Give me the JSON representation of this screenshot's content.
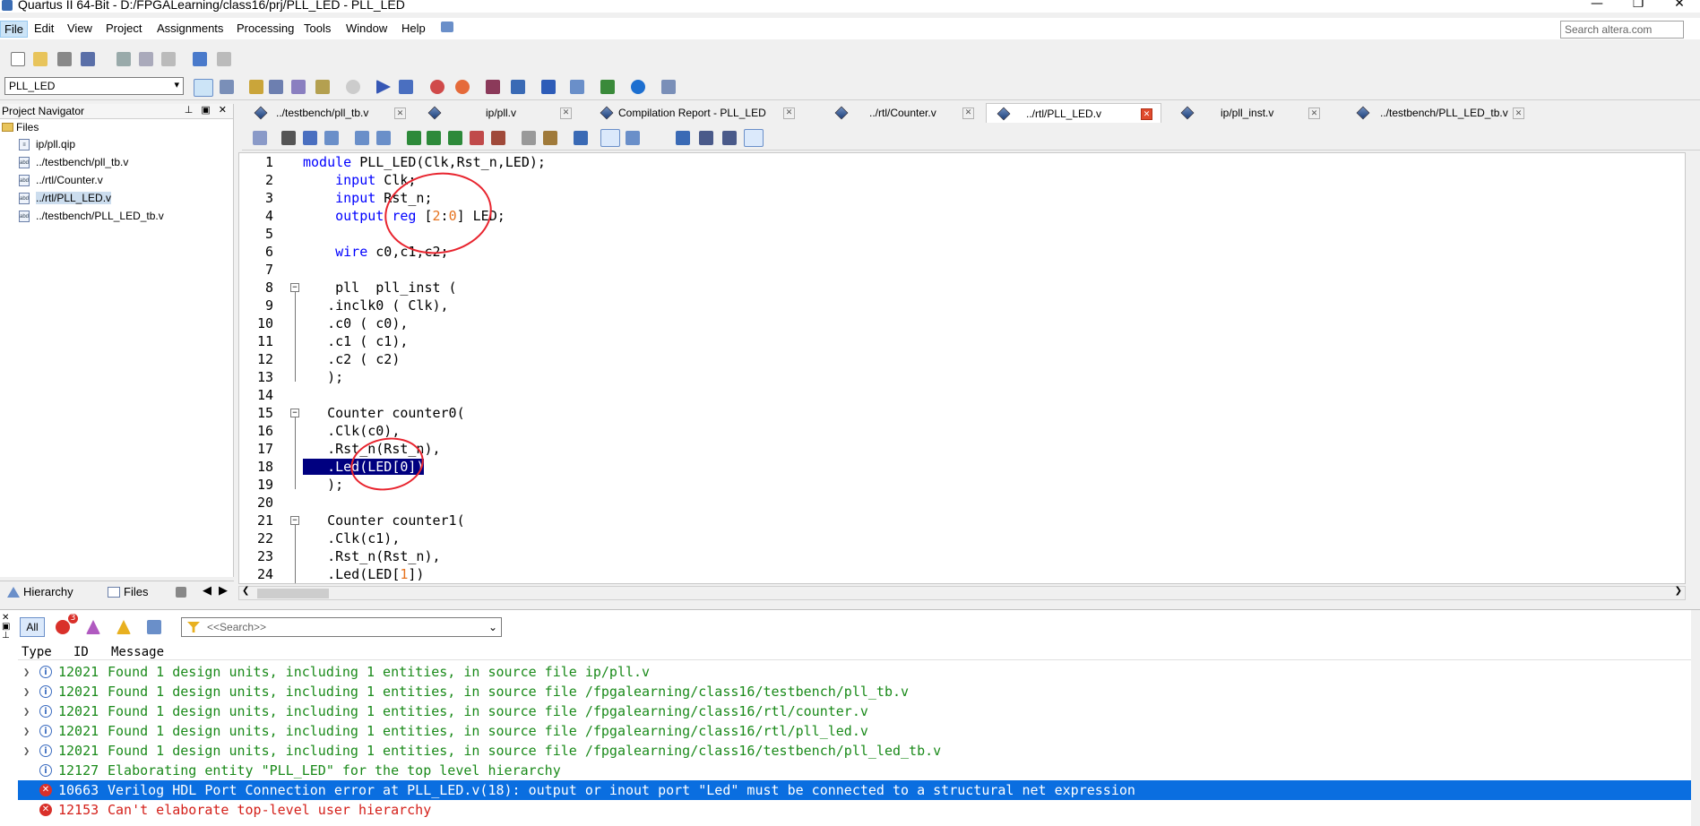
{
  "window": {
    "title": "Quartus II 64-Bit - D:/FPGALearning/class16/prj/PLL_LED - PLL_LED",
    "minimize": "—",
    "maximize": "❐",
    "close": "✕"
  },
  "menu": {
    "items": [
      "File",
      "Edit",
      "View",
      "Project",
      "Assignments",
      "Processing",
      "Tools",
      "Window",
      "Help"
    ],
    "search_placeholder": "Search altera.com"
  },
  "toolbar": {
    "project_select": "PLL_LED"
  },
  "navigator": {
    "title": "Project Navigator",
    "header_buttons": "⊥ ▣ ✕",
    "root": "Files",
    "files": [
      "ip/pll.qip",
      "../testbench/pll_tb.v",
      "../rtl/Counter.v",
      "../rtl/PLL_LED.v",
      "../testbench/PLL_LED_tb.v"
    ],
    "selected_index": 3,
    "tabs": [
      "Hierarchy",
      "Files"
    ]
  },
  "tabs": [
    {
      "label": "../testbench/pll_tb.v",
      "active": false
    },
    {
      "label": "ip/pll.v",
      "active": false
    },
    {
      "label": "Compilation Report - PLL_LED",
      "active": false
    },
    {
      "label": "../rtl/Counter.v",
      "active": false
    },
    {
      "label": "../rtl/PLL_LED.v",
      "active": true
    },
    {
      "label": "ip/pll_inst.v",
      "active": false
    },
    {
      "label": "../testbench/PLL_LED_tb.v",
      "active": false
    }
  ],
  "editor": {
    "line_numbers": [
      "1",
      "2",
      "3",
      "4",
      "5",
      "6",
      "7",
      "8",
      "9",
      "10",
      "11",
      "12",
      "13",
      "14",
      "15",
      "16",
      "17",
      "18",
      "19",
      "20",
      "21",
      "22",
      "23",
      "24"
    ],
    "highlighted_line": 18
  },
  "messages": {
    "all_label": "All",
    "error_count": "3",
    "search_placeholder": "<<Search>>",
    "columns": {
      "type": "Type",
      "id": "ID",
      "message": "Message"
    },
    "rows": [
      {
        "kind": "info",
        "id": "12021",
        "text": "Found 1 design units, including 1 entities, in source file ip/pll.v"
      },
      {
        "kind": "info",
        "id": "12021",
        "text": "Found 1 design units, including 1 entities, in source file /fpgalearning/class16/testbench/pll_tb.v"
      },
      {
        "kind": "info",
        "id": "12021",
        "text": "Found 1 design units, including 1 entities, in source file /fpgalearning/class16/rtl/counter.v"
      },
      {
        "kind": "info",
        "id": "12021",
        "text": "Found 1 design units, including 1 entities, in source file /fpgalearning/class16/rtl/pll_led.v"
      },
      {
        "kind": "info",
        "id": "12021",
        "text": "Found 1 design units, including 1 entities, in source file /fpgalearning/class16/testbench/pll_led_tb.v"
      },
      {
        "kind": "elab",
        "id": "12127",
        "text": "Elaborating entity \"PLL_LED\" for the top level hierarchy"
      },
      {
        "kind": "sel",
        "id": "10663",
        "text": "Verilog HDL Port Connection error at PLL_LED.v(18): output or inout port \"Led\" must be connected to a structural net expression"
      },
      {
        "kind": "err",
        "id": "12153",
        "text": "Can't elaborate top-level user hierarchy"
      }
    ]
  },
  "colors": {
    "keyword": "#0000ff",
    "number": "#e6731f",
    "selection": "#000080",
    "info_text": "#1a8a1a",
    "error_text": "#d4201a",
    "selected_row": "#0a6ee0"
  }
}
